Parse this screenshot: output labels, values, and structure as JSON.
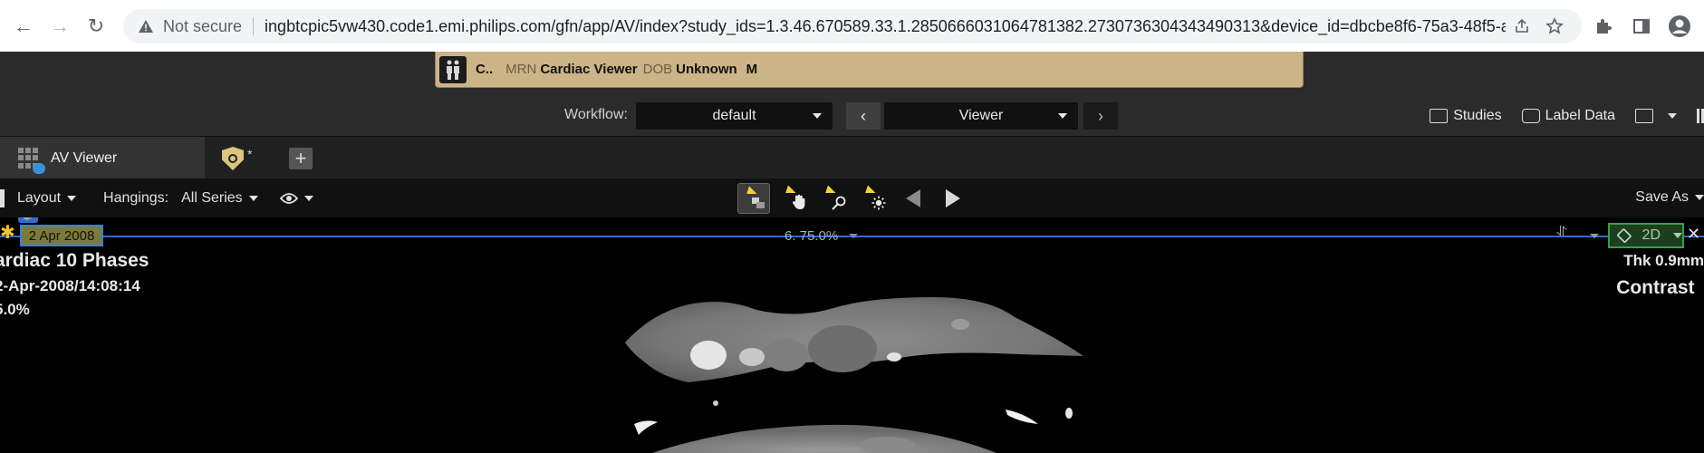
{
  "browser": {
    "url": "ingbtcpic5vw430.code1.emi.philips.com/gfn/app/AV/index?study_ids=1.3.46.670589.33.1.2850666031064781382.2730736304343490313&device_id=dbcbe8f6-75a3-48f5-aafc-...",
    "security_label": "Not secure"
  },
  "patient": {
    "name": "C..",
    "mrn_label": "MRN",
    "study_name": "Cardiac Viewer",
    "dob_label": "DOB",
    "dob_value": "Unknown",
    "sex": "M"
  },
  "workflow": {
    "label": "Workflow:",
    "selected": "default",
    "stage": "Viewer"
  },
  "header_right": {
    "studies": "Studies",
    "label_data": "Label Data"
  },
  "tabs": [
    {
      "label": "AV Viewer"
    },
    {
      "label": "*"
    }
  ],
  "toolbar": {
    "layout": "Layout",
    "hangings_label": "Hangings:",
    "hangings_value": "All Series",
    "save_as": "Save As"
  },
  "viewport": {
    "date_chip": "2 Apr 2008",
    "zoom_text": "6. 75.0%",
    "mode_badge": "2D",
    "overlay_left": {
      "title": "ardiac 10 Phases",
      "datetime": "2-Apr-2008/14:08:14",
      "phase": "5.0%"
    },
    "overlay_right": {
      "thickness": "Thk 0.9mm",
      "contrast": "Contrast"
    }
  },
  "colors": {
    "patient_bar": "#cbb487",
    "accent_blue": "#2f6fd1",
    "accent_green": "#2ea63a",
    "highlight_yellow": "#f2d13a"
  }
}
